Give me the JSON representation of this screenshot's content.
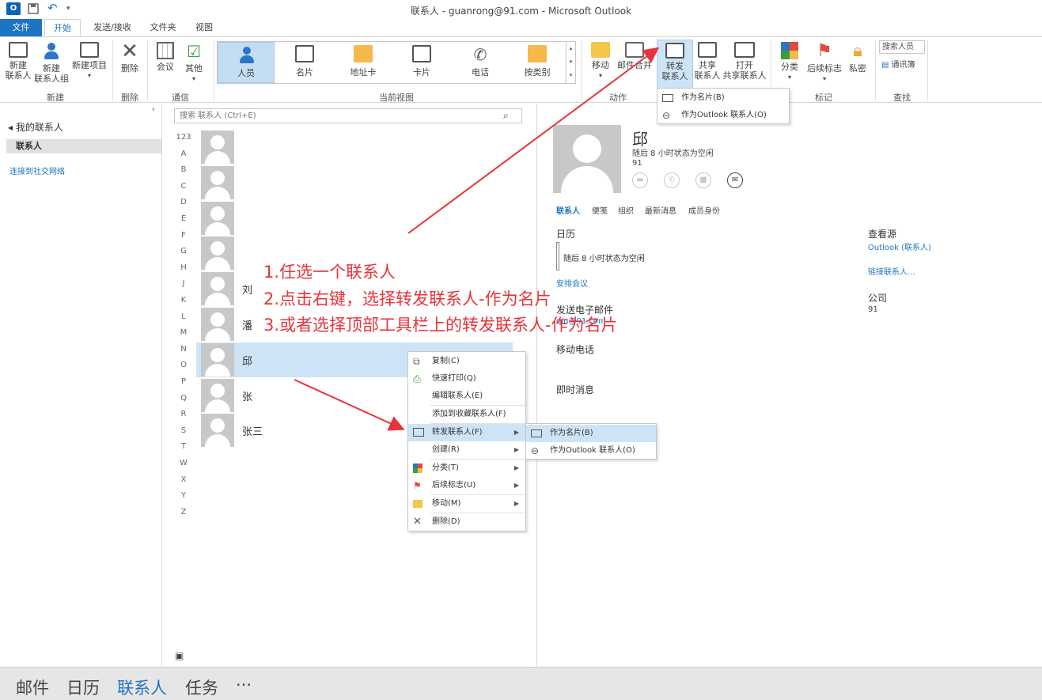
{
  "window": {
    "title": "联系人 - guanrong@91.com - Microsoft Outlook"
  },
  "tabs": [
    "文件",
    "开始",
    "发送/接收",
    "文件夹",
    "视图"
  ],
  "ribbon": {
    "new_group": {
      "label": "新建",
      "new_contact": "新建\n联系人",
      "new_group": "新建\n联系人组",
      "new_item": "新建项目"
    },
    "delete_group": {
      "label": "删除",
      "delete": "删除"
    },
    "comm_group": {
      "label": "通信",
      "meeting": "会议",
      "other": "其他"
    },
    "view_group": {
      "label": "当前视图",
      "views": [
        "人员",
        "名片",
        "地址卡",
        "卡片",
        "电话",
        "按类别"
      ]
    },
    "actions_group": {
      "label": "动作",
      "move": "移动",
      "merge": "邮件合并",
      "forward": "转发\n联系人",
      "share": "共享\n联系人",
      "open_shared": "打开\n共享联系人"
    },
    "tags_group": {
      "label": "标记",
      "categorize": "分类",
      "followup": "后续标志",
      "private": "私密"
    },
    "find_group": {
      "label": "查找",
      "search_people": "搜索人员",
      "address_book": "通讯簿"
    }
  },
  "forward_dropdown": [
    "作为名片(B)",
    "作为Outlook 联系人(O)"
  ],
  "nav": {
    "group": "◂ 我的联系人",
    "contacts": "联系人",
    "social": "连接到社交网络"
  },
  "list": {
    "search_placeholder": "搜索 联系人 (Ctrl+E)",
    "alphabet": [
      "123",
      "A",
      "B",
      "C",
      "D",
      "E",
      "F",
      "G",
      "H",
      "J",
      "K",
      "L",
      "M",
      "N",
      "O",
      "P",
      "Q",
      "R",
      "S",
      "T",
      "W",
      "X",
      "Y",
      "Z"
    ],
    "contacts": [
      "",
      "",
      "",
      "",
      "刘",
      "潘",
      "邱",
      "张",
      "张三"
    ]
  },
  "detail": {
    "name": "邱",
    "status": "随后 8 小时状态为空闲",
    "company_short": "91",
    "tabs": [
      "联系人",
      "便笺",
      "组织",
      "最新消息",
      "成员身份"
    ],
    "calendar_h": "日历",
    "calendar_status": "随后 8 小时状态为空闲",
    "schedule": "安排会议",
    "email_h": "发送电子邮件",
    "email_value": "qiu@91.com",
    "mobile_h": "移动电话",
    "im_h": "即时消息",
    "source_h": "查看源",
    "source_value": "Outlook (联系人)",
    "link_contacts": "链接联系人...",
    "company_h": "公司",
    "company_value": "91"
  },
  "context_menu": {
    "items": [
      "复制(C)",
      "快速打印(Q)",
      "编辑联系人(E)",
      "添加到收藏联系人(F)",
      "转发联系人(F)",
      "创建(R)",
      "分类(T)",
      "后续标志(U)",
      "移动(M)",
      "删除(D)"
    ],
    "submenu": [
      "作为名片(B)",
      "作为Outlook 联系人(O)"
    ]
  },
  "annotation": {
    "line1": "1.任选一个联系人",
    "line2": "2.点击右键，选择转发联系人-作为名片",
    "line3": "3.或者选择顶部工具栏上的转发联系人-作为名片"
  },
  "bottom_nav": [
    "邮件",
    "日历",
    "联系人",
    "任务",
    "···"
  ],
  "colors": {
    "accent": "#1e74c4",
    "selected": "#cde4f7",
    "annotation": "#e8333a"
  }
}
